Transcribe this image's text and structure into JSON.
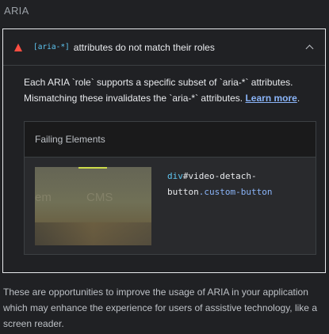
{
  "section": {
    "title": "ARIA"
  },
  "audit": {
    "code_label": "[aria-*]",
    "title_rest": "attributes do not match their roles",
    "description": "Each ARIA `role` supports a specific subset of `aria-*` attributes. Mismatching these invalidates the `aria-*` attributes.",
    "learn_more": "Learn more",
    "description_end": "."
  },
  "table": {
    "header": "Failing Elements",
    "rows": [
      {
        "thumb_text_a": "em",
        "thumb_text_b": "CMS",
        "selector_tag": "div",
        "selector_id": "#video-detach-button",
        "selector_class": ".custom-button"
      }
    ]
  },
  "footer": {
    "text": "These are opportunities to improve the usage of ARIA in your application which may enhance the experience for users of assistive technology, like a screen reader."
  },
  "colors": {
    "fail": "#ff4e42",
    "link": "#8ab4f8",
    "code": "#5ec5f1"
  }
}
